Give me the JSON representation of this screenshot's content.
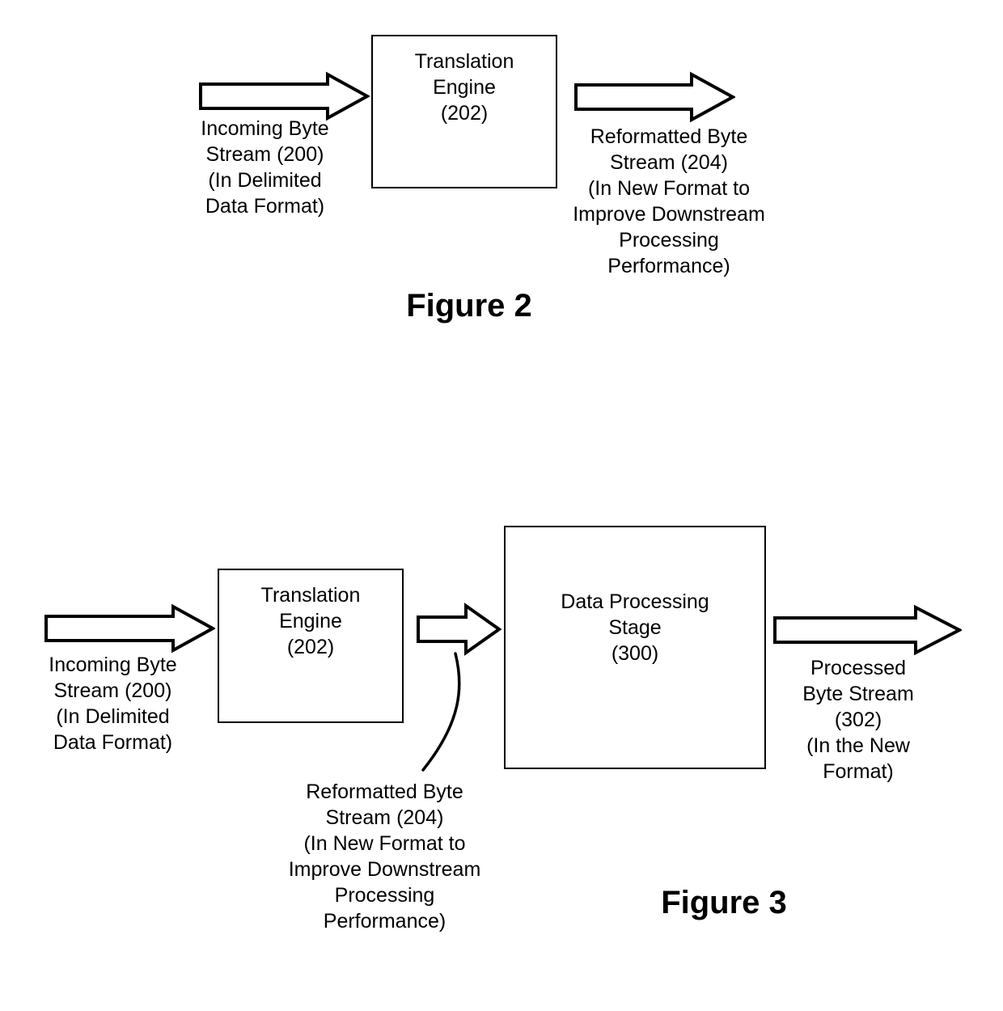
{
  "document": {
    "type": "patent-drawing-sheet",
    "background_color": "#ffffff",
    "line_color": "#000000"
  },
  "figure2": {
    "title": "Figure 2",
    "input_arrow_icon": "right-block-arrow-icon",
    "output_arrow_icon": "right-block-arrow-icon",
    "box": {
      "label": "Translation\nEngine\n(202)",
      "reference_numeral": "202"
    },
    "input_caption": "Incoming Byte\nStream (200)\n(In Delimited\nData Format)",
    "input_reference_numeral": "200",
    "output_caption": "Reformatted Byte\nStream (204)\n(In New Format to\nImprove Downstream\nProcessing\nPerformance)",
    "output_reference_numeral": "204"
  },
  "figure3": {
    "title": "Figure 3",
    "input_arrow_icon": "right-block-arrow-icon",
    "middle_arrow_icon": "right-block-arrow-icon",
    "output_arrow_icon": "right-block-arrow-icon",
    "leader_line_icon": "curved-leader-line-icon",
    "translation_box": {
      "label": "Translation\nEngine\n(202)",
      "reference_numeral": "202"
    },
    "processing_box": {
      "label": "Data Processing\nStage\n(300)",
      "reference_numeral": "300"
    },
    "input_caption": "Incoming Byte\nStream (200)\n(In Delimited\nData Format)",
    "input_reference_numeral": "200",
    "middle_caption": "Reformatted Byte\nStream (204)\n(In New Format to\nImprove Downstream\nProcessing\nPerformance)",
    "middle_reference_numeral": "204",
    "output_caption": "Processed\nByte Stream\n(302)\n(In the New\nFormat)",
    "output_reference_numeral": "302"
  }
}
